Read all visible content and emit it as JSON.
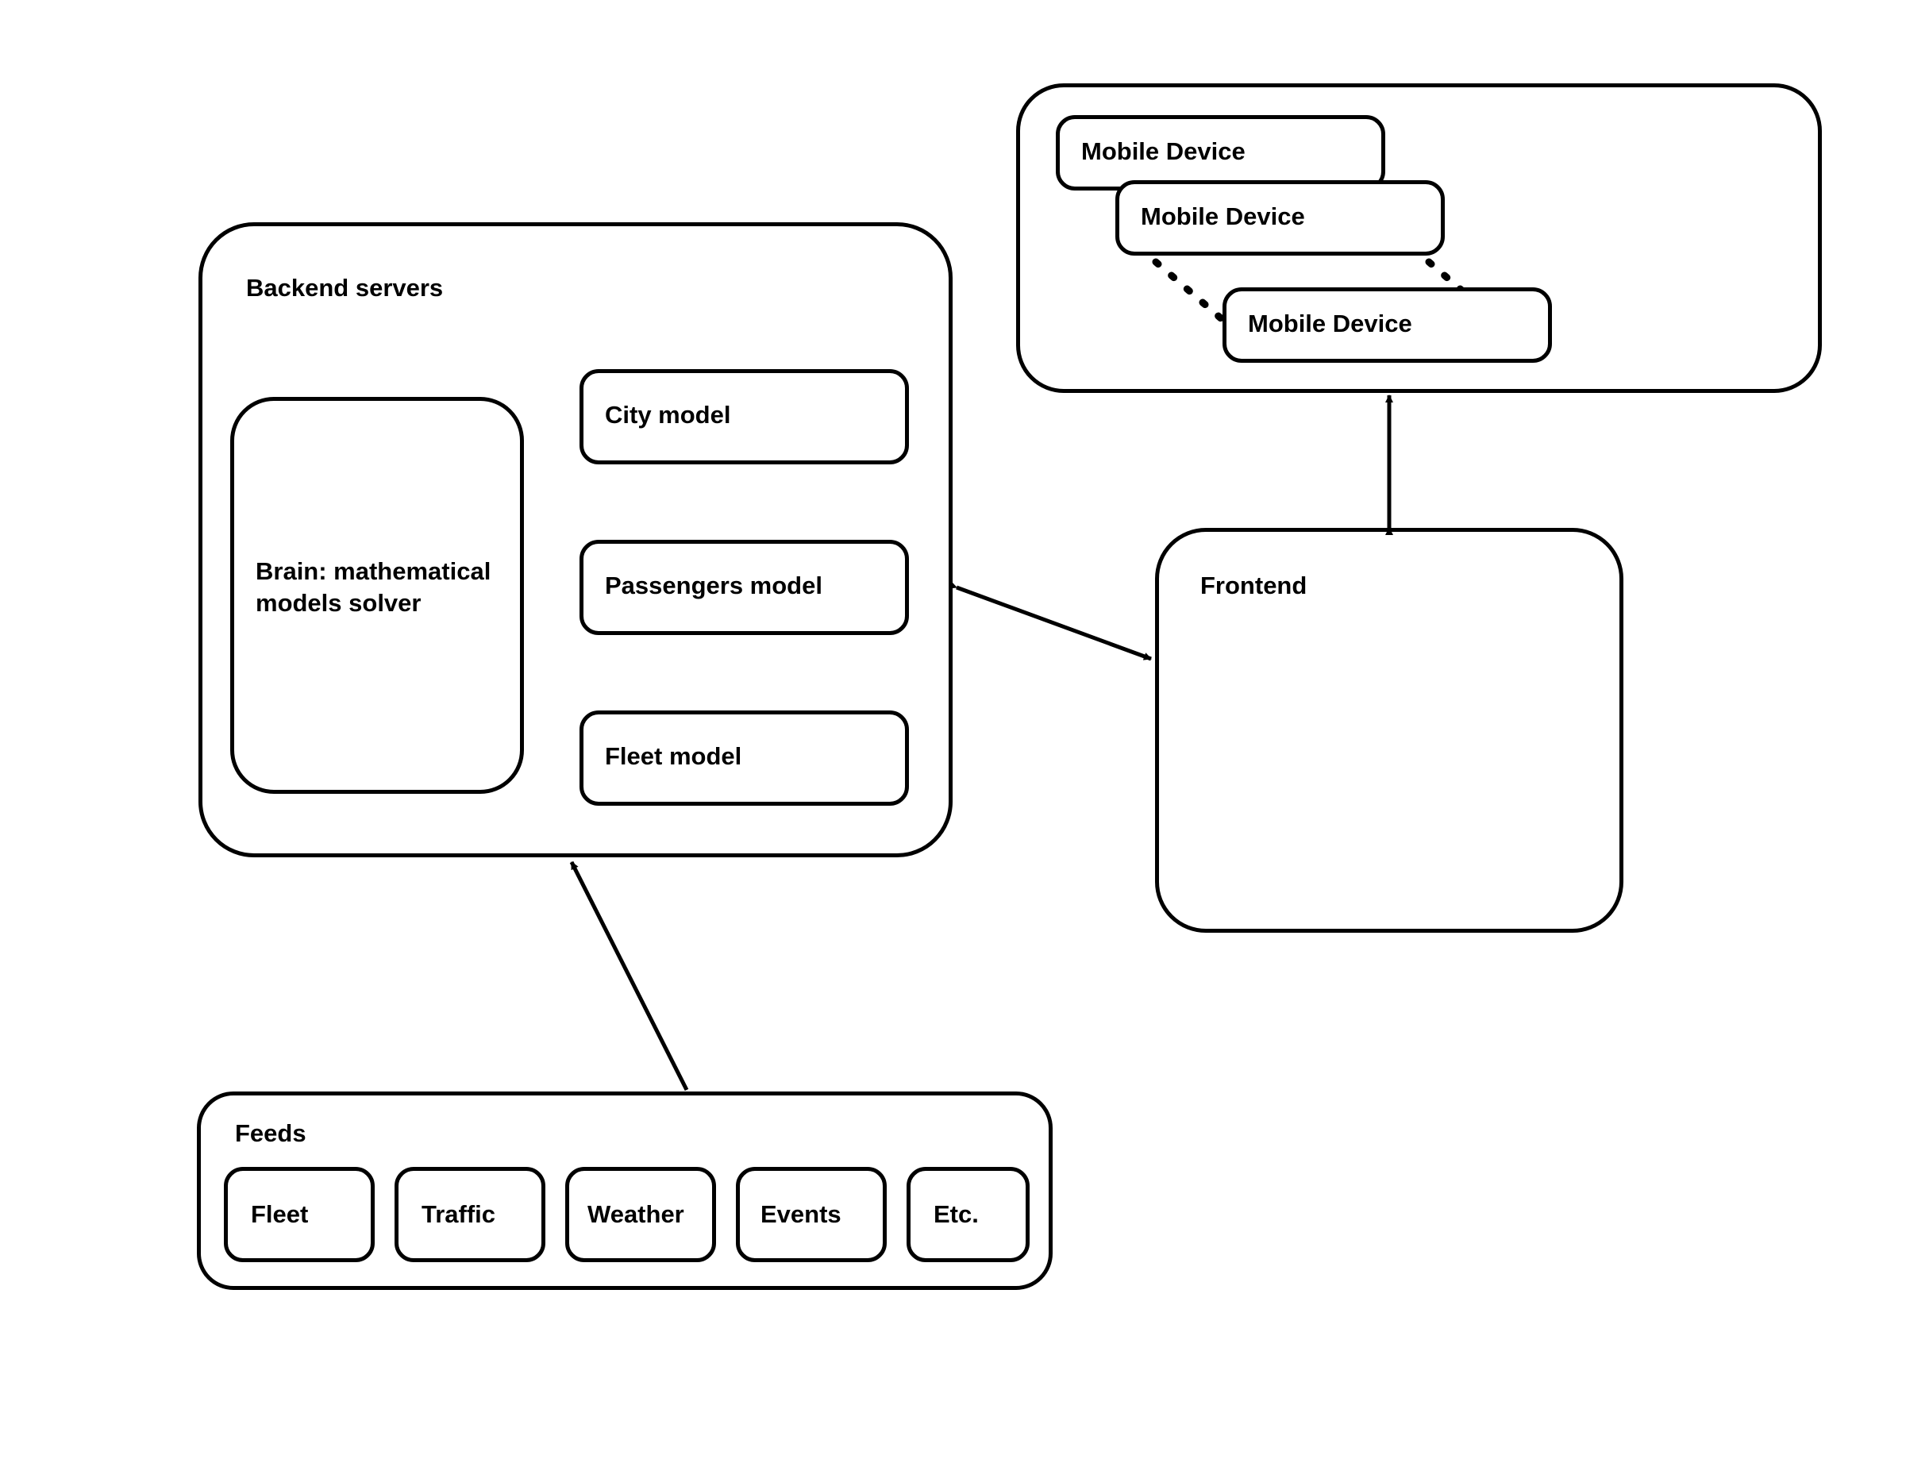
{
  "backend": {
    "title": "Backend servers",
    "brain": "Brain:\nmathematical\nmodels solver",
    "models": {
      "city": "City model",
      "passengers": "Passengers model",
      "fleet": "Fleet model"
    }
  },
  "mobile": {
    "device1": "Mobile Device",
    "device2": "Mobile Device",
    "device3": "Mobile Device"
  },
  "frontend": {
    "title": "Frontend"
  },
  "feeds": {
    "title": "Feeds",
    "items": {
      "fleet": "Fleet",
      "traffic": "Traffic",
      "weather": "Weather",
      "events": "Events",
      "etc": "Etc."
    }
  }
}
